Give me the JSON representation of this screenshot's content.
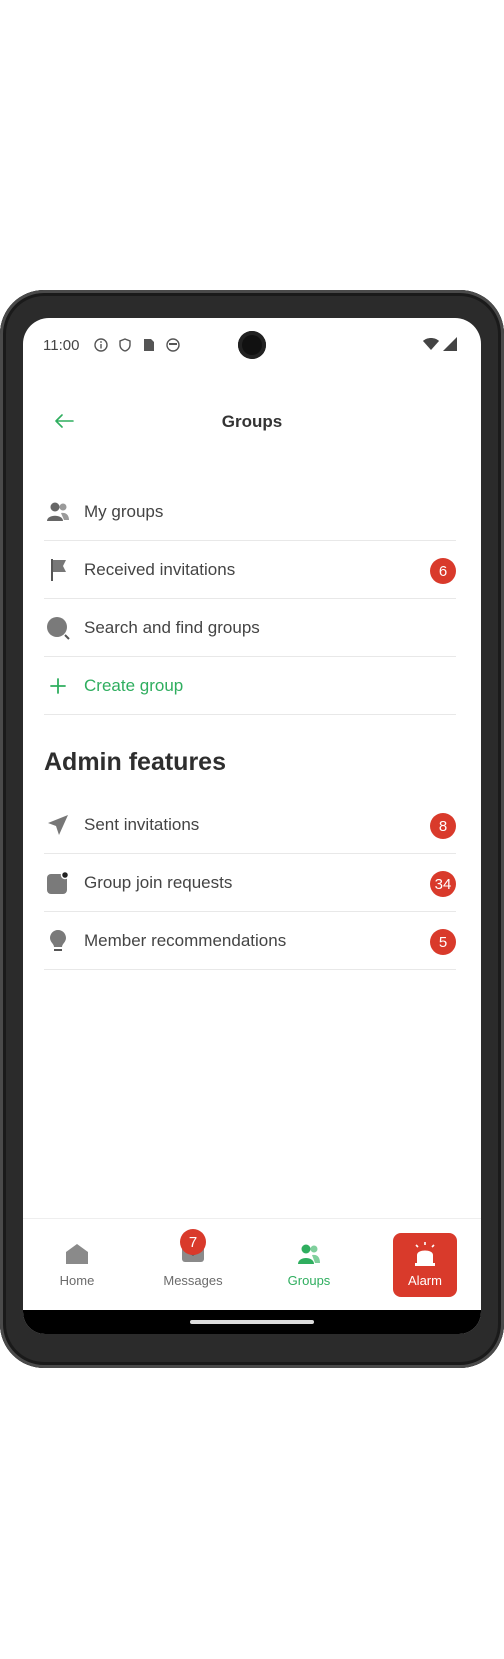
{
  "status_bar": {
    "time": "11:00",
    "icons": [
      "info-icon",
      "shield-icon",
      "sim-icon",
      "face-icon"
    ],
    "right_icons": [
      "wifi-icon",
      "signal-icon"
    ]
  },
  "app_bar": {
    "title": "Groups",
    "back_icon": "arrow-left-icon"
  },
  "groups_menu": [
    {
      "label": "My groups",
      "icon": "people-icon"
    },
    {
      "label": "Received invitations",
      "icon": "flag-icon",
      "badge": "6"
    },
    {
      "label": "Search and find groups",
      "icon": "search-icon"
    },
    {
      "label": "Create group",
      "icon": "plus-icon"
    }
  ],
  "admin": {
    "title": "Admin features",
    "items": [
      {
        "label": "Sent invitations",
        "icon": "send-icon",
        "badge": "8"
      },
      {
        "label": "Group join requests",
        "icon": "notification-square-icon",
        "badge": "34"
      },
      {
        "label": "Member recommendations",
        "icon": "lightbulb-icon",
        "badge": "5"
      }
    ]
  },
  "bottom_nav": {
    "home": "Home",
    "messages": "Messages",
    "messages_badge": "7",
    "groups": "Groups",
    "alarm": "Alarm"
  },
  "colors": {
    "accent_green": "#2fae5f",
    "badge_red": "#d93a2b",
    "alarm_red": "#d93a2b"
  }
}
